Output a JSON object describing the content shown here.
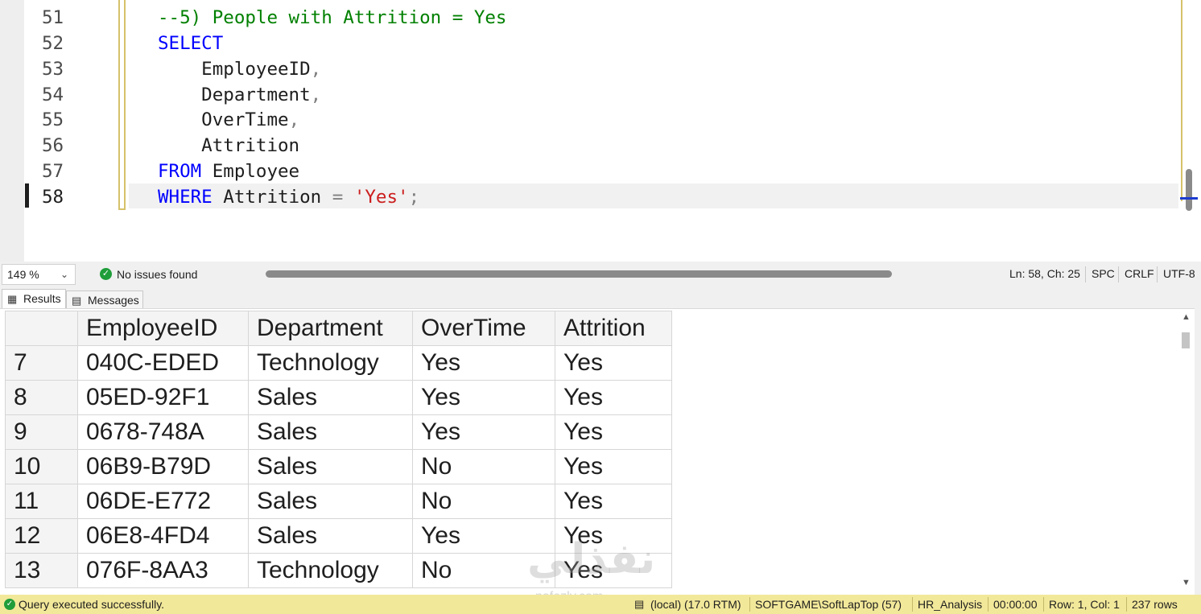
{
  "editor": {
    "lines": [
      {
        "num": "51",
        "tokens": [
          {
            "t": "--5) People with Attrition = Yes",
            "c": "cm"
          }
        ]
      },
      {
        "num": "52",
        "tokens": [
          {
            "t": "SELECT",
            "c": "kw"
          }
        ]
      },
      {
        "num": "53",
        "tokens": [
          {
            "t": "    EmployeeID",
            "c": ""
          },
          {
            "t": ",",
            "c": "pun"
          }
        ]
      },
      {
        "num": "54",
        "tokens": [
          {
            "t": "    Department",
            "c": ""
          },
          {
            "t": ",",
            "c": "pun"
          }
        ]
      },
      {
        "num": "55",
        "tokens": [
          {
            "t": "    OverTime",
            "c": ""
          },
          {
            "t": ",",
            "c": "pun"
          }
        ]
      },
      {
        "num": "56",
        "tokens": [
          {
            "t": "    Attrition",
            "c": ""
          }
        ]
      },
      {
        "num": "57",
        "tokens": [
          {
            "t": "FROM",
            "c": "kw"
          },
          {
            "t": " Employee",
            "c": ""
          }
        ]
      },
      {
        "num": "58",
        "tokens": [
          {
            "t": "WHERE",
            "c": "kw"
          },
          {
            "t": " Attrition ",
            "c": ""
          },
          {
            "t": "=",
            "c": "pun"
          },
          {
            "t": " ",
            "c": ""
          },
          {
            "t": "'Yes'",
            "c": "str"
          },
          {
            "t": ";",
            "c": "pun"
          }
        ]
      }
    ]
  },
  "editor_status": {
    "zoom": "149 %",
    "issues": "No issues found",
    "cursor": "Ln: 58, Ch: 25",
    "whitespace": "SPC",
    "line_endings": "CRLF",
    "encoding": "UTF-8"
  },
  "tabs": {
    "results": "Results",
    "messages": "Messages"
  },
  "grid": {
    "columns": [
      "EmployeeID",
      "Department",
      "OverTime",
      "Attrition"
    ],
    "rows": [
      {
        "n": "7",
        "cells": [
          "040C-EDED",
          "Technology",
          "Yes",
          "Yes"
        ]
      },
      {
        "n": "8",
        "cells": [
          "05ED-92F1",
          "Sales",
          "Yes",
          "Yes"
        ]
      },
      {
        "n": "9",
        "cells": [
          "0678-748A",
          "Sales",
          "Yes",
          "Yes"
        ]
      },
      {
        "n": "10",
        "cells": [
          "06B9-B79D",
          "Sales",
          "No",
          "Yes"
        ]
      },
      {
        "n": "11",
        "cells": [
          "06DE-E772",
          "Sales",
          "No",
          "Yes"
        ]
      },
      {
        "n": "12",
        "cells": [
          "06E8-4FD4",
          "Sales",
          "Yes",
          "Yes"
        ]
      },
      {
        "n": "13",
        "cells": [
          "076F-8AA3",
          "Technology",
          "No",
          "Yes"
        ]
      }
    ]
  },
  "watermark": {
    "text": "نفذلي",
    "sub": "nafezly.com"
  },
  "query_status": {
    "message": "Query executed successfully.",
    "server": "(local) (17.0 RTM)",
    "login": "SOFTGAME\\SoftLapTop (57)",
    "database": "HR_Analysis",
    "elapsed": "00:00:00",
    "position": "Row: 1, Col: 1",
    "row_count": "237 rows"
  }
}
